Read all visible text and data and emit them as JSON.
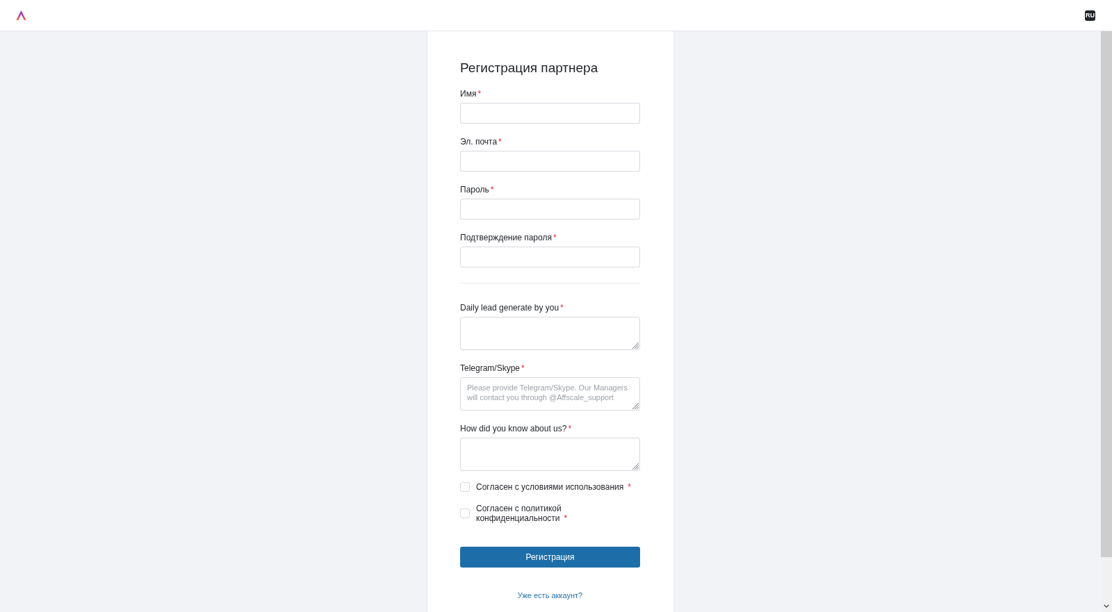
{
  "header": {
    "language": "RU"
  },
  "form": {
    "title": "Регистрация партнера",
    "sections": [
      {
        "fields": [
          {
            "kind": "input",
            "label": "Имя",
            "required_mark": "*"
          },
          {
            "kind": "input",
            "label": "Эл. почта",
            "required_mark": "*"
          },
          {
            "kind": "input",
            "label": "Пароль",
            "required_mark": "*"
          },
          {
            "kind": "input",
            "label": "Подтверждение пароля",
            "required_mark": "*"
          }
        ]
      },
      {
        "fields": [
          {
            "kind": "textarea",
            "label": "Daily lead generate by you",
            "required_mark": "*"
          },
          {
            "kind": "textarea",
            "label": "Telegram/Skype",
            "required_mark": "*",
            "placeholder": "Please provide Telegram/Skype. Our Managers will contact you through @Affscale_support"
          },
          {
            "kind": "textarea",
            "label": "How did you know about us?",
            "required_mark": "*"
          }
        ]
      }
    ],
    "agreements": [
      {
        "label": "Согласен с условиями использования",
        "required_mark": "*",
        "checked": false
      },
      {
        "label": "Согласен с политикой конфиденциальности",
        "required_mark": "*",
        "checked": false
      }
    ],
    "submit_button": "Регистрация",
    "login_link": "Уже есть аккаунт?"
  }
}
